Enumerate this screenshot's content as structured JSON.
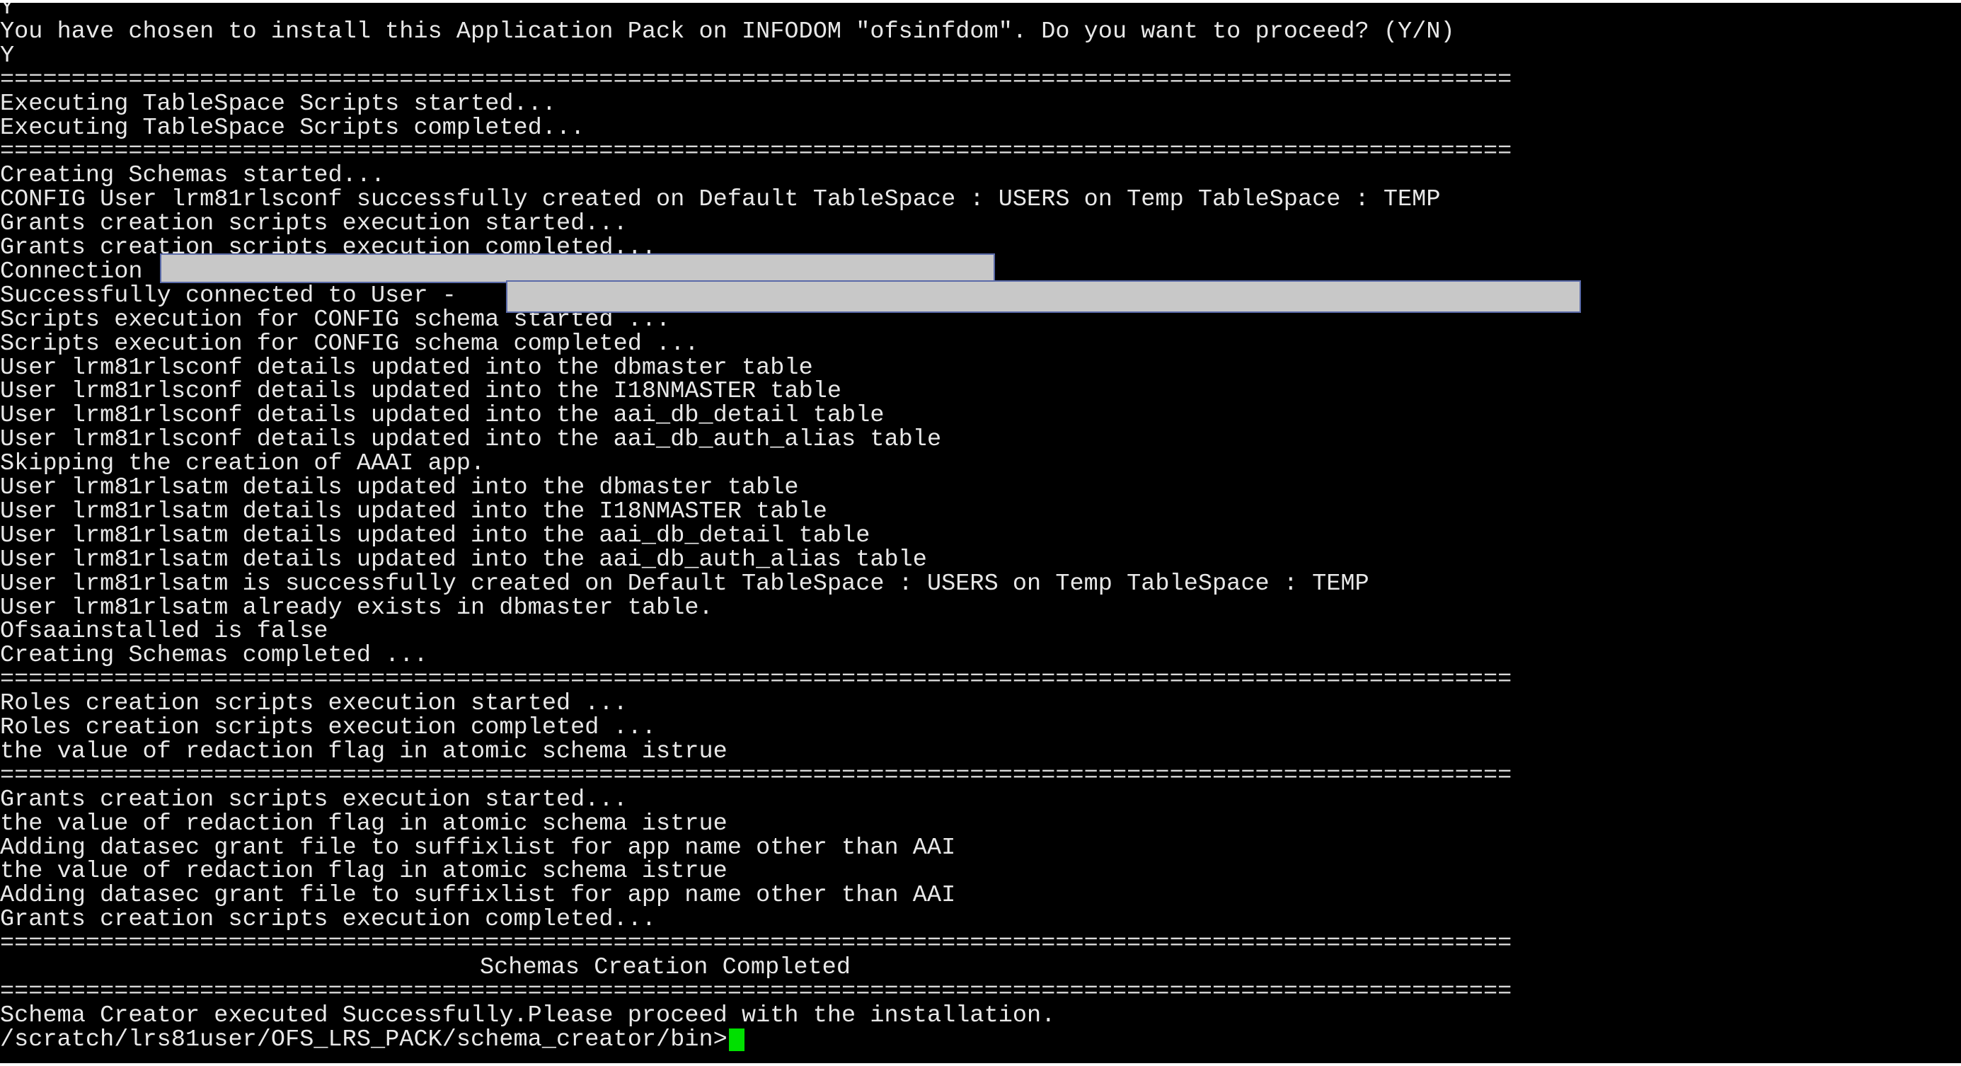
{
  "terminal": {
    "lines": [
      "Y",
      "You have chosen to install this Application Pack on INFODOM \"ofsinfdom\". Do you want to proceed? (Y/N)",
      "Y",
      "==========================================================================================================",
      "Executing TableSpace Scripts started...",
      "Executing TableSpace Scripts completed...",
      "==========================================================================================================",
      "Creating Schemas started...",
      "CONFIG User lrm81rlsconf successfully created on Default TableSpace : USERS on Temp TableSpace : TEMP",
      "Grants creation scripts execution started...",
      "Grants creation scripts execution completed...",
      "Connection",
      "Successfully connected to User -",
      "Scripts execution for CONFIG schema started ...",
      "Scripts execution for CONFIG schema completed ...",
      "User lrm81rlsconf details updated into the dbmaster table",
      "User lrm81rlsconf details updated into the I18NMASTER table",
      "User lrm81rlsconf details updated into the aai_db_detail table",
      "User lrm81rlsconf details updated into the aai_db_auth_alias table",
      "Skipping the creation of AAAI app.",
      "User lrm81rlsatm details updated into the dbmaster table",
      "User lrm81rlsatm details updated into the I18NMASTER table",
      "User lrm81rlsatm details updated into the aai_db_detail table",
      "User lrm81rlsatm details updated into the aai_db_auth_alias table",
      "User lrm81rlsatm is successfully created on Default TableSpace : USERS on Temp TableSpace : TEMP",
      "User lrm81rlsatm already exists in dbmaster table.",
      "Ofsaainstalled is false",
      "Creating Schemas completed ...",
      "==========================================================================================================",
      "Roles creation scripts execution started ...",
      "Roles creation scripts execution completed ...",
      "the value of redaction flag in atomic schema istrue",
      "==========================================================================================================",
      "Grants creation scripts execution started...",
      "the value of redaction flag in atomic schema istrue",
      "Adding datasec grant file to suffixlist for app name other than AAI",
      "the value of redaction flag in atomic schema istrue",
      "Adding datasec grant file to suffixlist for app name other than AAI",
      "Grants creation scripts execution completed...",
      "==========================================================================================================",
      "Schemas Creation Completed",
      "==========================================================================================================",
      "Schema Creator executed Successfully.Please proceed with the installation.",
      "/scratch/lrs81user/OFS_LRS_PACK/schema_creator/bin>"
    ]
  },
  "colors": {
    "background": "#000000",
    "text": "#e8e8e8",
    "cursor": "#00e000",
    "redaction": "#c8c8c8"
  }
}
